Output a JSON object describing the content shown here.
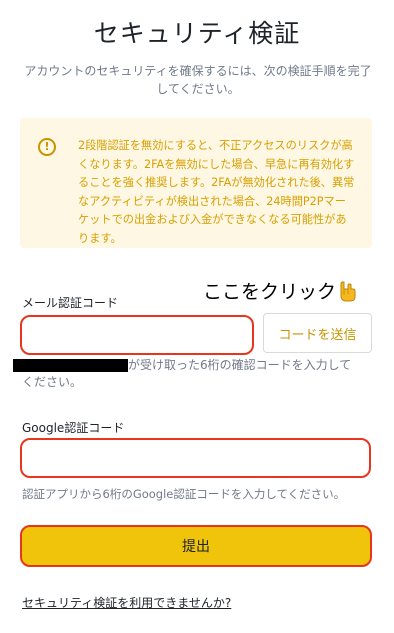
{
  "page": {
    "title": "セキュリティ検証",
    "subtitle": "アカウントのセキュリティを確保するには、次の検証手順を完了してください。"
  },
  "warning": {
    "icon": "alert-circle-icon",
    "text": "2段階認証を無効にすると、不正アクセスのリスクが高くなります。2FAを無効にした場合、早急に再有効化することを強く推奨します。2FAが無効化された後、異常なアクティビティが検出された場合、24時間P2Pマーケットでの出金および入金ができなくなる可能性があります。",
    "color": "#d89f00",
    "background": "#fdf7e3"
  },
  "annotation": {
    "text": "ここをクリック",
    "icon": "pointing-hand-icon"
  },
  "email": {
    "label": "メール認証コード",
    "value": "",
    "send_button": "コードを送信",
    "hint_suffix": "が受け取った6桁の確認コードを入力して",
    "hint_line2": "ください。"
  },
  "google": {
    "label": "Google認証コード",
    "value": "",
    "hint": "認証アプリから6桁のGoogle認証コードを入力してください。"
  },
  "submit": {
    "label": "提出"
  },
  "footer": {
    "link": "セキュリティ検証を利用できませんか?"
  },
  "colors": {
    "accent": "#f0c40a",
    "highlight_border": "#e8361e",
    "link_text": "#c99400"
  }
}
